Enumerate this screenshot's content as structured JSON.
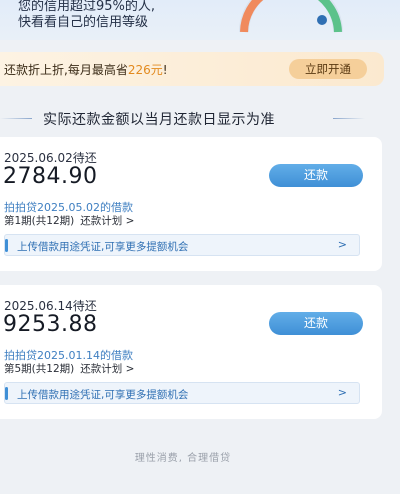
{
  "top_banner": {
    "line1": "您的信用超过95%的人,",
    "line2": "快看看自己的信用等级"
  },
  "promo": {
    "text_prefix": "还款折上折,每月最高省",
    "amount": "226元",
    "text_suffix": "!",
    "button": "立即开通"
  },
  "notice": "实际还款金额以当月还款日显示为准",
  "bills": [
    {
      "due": "2025.06.02待还",
      "amount": "2784.90",
      "repay_label": "还款",
      "loan": "拍拍贷2025.05.02的借款",
      "period": "第1期(共12期)",
      "plan": "还款计划 >",
      "upload": "上传借款用途凭证,可享更多提额机会",
      "chevron": ">"
    },
    {
      "due": "2025.06.14待还",
      "amount": "9253.88",
      "repay_label": "还款",
      "loan": "拍拍贷2025.01.14的借款",
      "period": "第5期(共12期)",
      "plan": "还款计划 >",
      "upload": "上传借款用途凭证,可享更多提额机会",
      "chevron": ">"
    }
  ],
  "footer": "理性消费, 合理借贷"
}
